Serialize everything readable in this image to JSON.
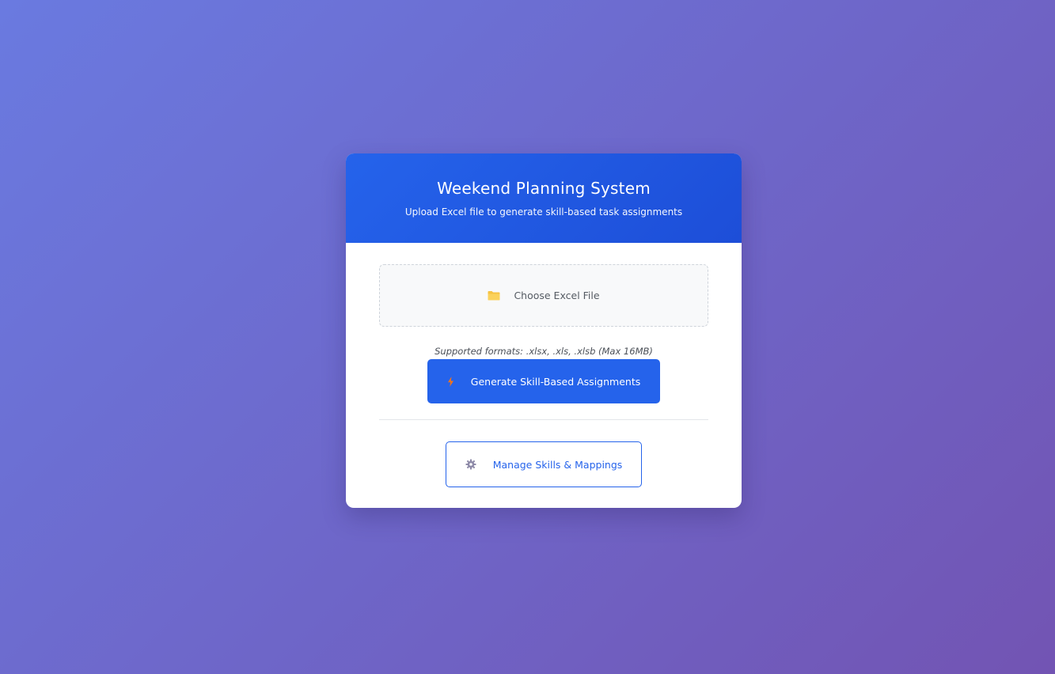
{
  "header": {
    "title": "Weekend Planning System",
    "subtitle": "Upload Excel file to generate skill-based task assignments"
  },
  "upload": {
    "icon": "folder-icon",
    "label": "Choose Excel File",
    "formats_note": "Supported formats: .xlsx, .xls, .xlsb (Max 16MB)"
  },
  "actions": {
    "generate": {
      "icon": "lightning-bolt-icon",
      "label": "Generate Skill-Based Assignments"
    },
    "manage": {
      "icon": "gear-icon",
      "label": "Manage Skills & Mappings"
    }
  },
  "colors": {
    "background_gradient_start": "#6a7ae0",
    "background_gradient_end": "#7254b3",
    "primary": "#2563eb",
    "folder": "#f6c344",
    "bolt": "#f97316"
  }
}
